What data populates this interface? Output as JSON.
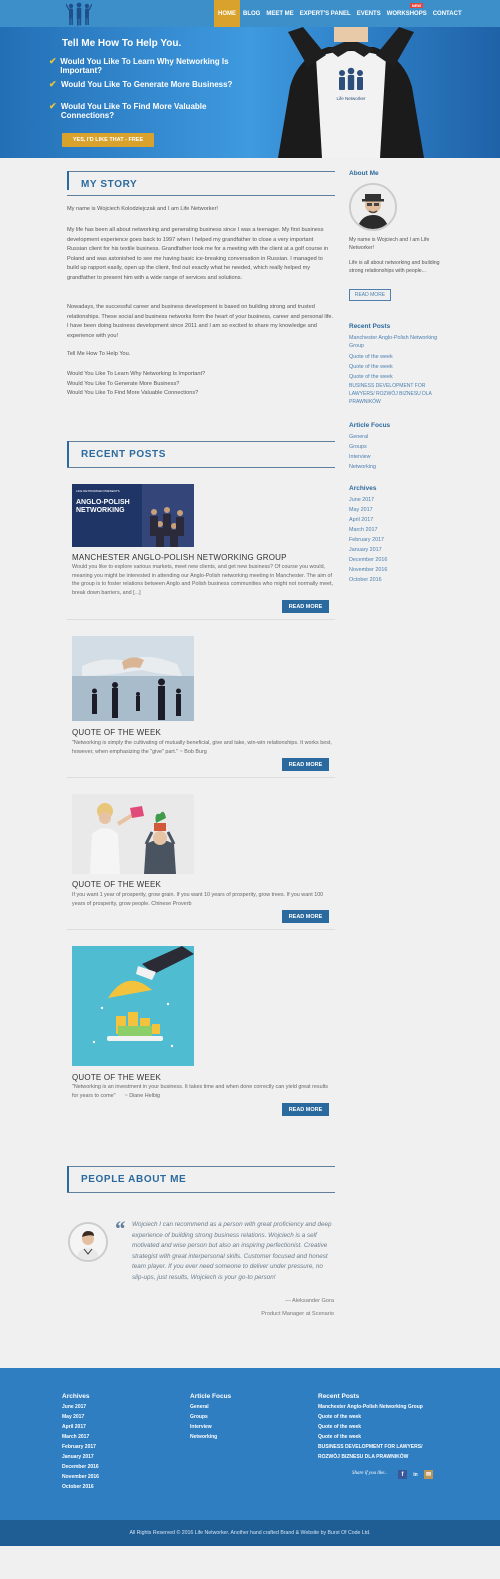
{
  "nav": {
    "items": [
      "HOME",
      "BLOG",
      "MEET ME",
      "EXPERT'S PANEL",
      "EVENTS",
      "WORKSHOPS",
      "CONTACT"
    ],
    "new_badge": "NEW"
  },
  "hero": {
    "title": "Tell Me How To Help You.",
    "items": [
      "Would You Like To Learn Why Networking Is Important?",
      "Would You Like To Generate More Business?",
      "Would You Like To Find More Valuable Connections?"
    ],
    "button": "YES, I'D LIKE THAT - FREE",
    "shirt_text": "Life Networker"
  },
  "story": {
    "title": "MY STORY",
    "paragraphs": [
      "My name is Wojciech Kolodziejczak and I am Life Networker!",
      "My life has been all about networking and generating business since I was a teenager. My first business development experience goes back to 1997 when I helped my grandfather to close a very important Russian client for his textile business. Grandfather took me for a meeting with the client at a golf course in Poland and was astonished to see me having basic ice-breaking conversation in Russian. I managed to build up rapport easily, open up the client, find out exactly what he needed, which really helped my grandfather to present him with a wide range of services and solutions.",
      "Nowadays, the successful career and business development is based on building strong and trusted relationships. These social and business networks form the heart of your business, career and personal life. I have been doing business development since 2011 and I am so excited to share my knowledge and experience with you!",
      "Tell Me How To Help You.",
      "Would You Like To Learn Why Networking Is Important?\nWould You Like To Generate More Business?\nWould You Like To Find More Valuable Connections?"
    ]
  },
  "recent": {
    "title": "RECENT POSTS",
    "read_more": "READ MORE",
    "posts": [
      {
        "title": "MANCHESTER ANGLO-POLISH NETWORKING GROUP",
        "excerpt": "Would you like to explore various markets, meet new clients, and get new business? Of course you would, meaning you might be interested in attending our Anglo-Polish networking meeting in Manchester. The aim of the group is to foster relations between Anglo and Polish business communities who might not normally meet, break down barriers, and [...]",
        "image_caption": "ANGLO-POLISH NETWORKING",
        "image_small": "LIFE NETWORKER PRESENTS"
      },
      {
        "title": "QUOTE OF THE WEEK",
        "excerpt": "\"Networking is simply the cultivating of mutually beneficial, give and take, win-win relationships. It works best, however, when emphasizing the \"give\" part.\" ~ Bob Burg"
      },
      {
        "title": "QUOTE OF THE WEEK",
        "excerpt": "If you want 1 year of prosperity, grow grain. If you want 10 years of prosperity, grow trees. If you want 100 years of prosperity, grow people. Chinese Proverb"
      },
      {
        "title": "QUOTE OF THE WEEK",
        "excerpt": "\"Networking is an investment in your business. It takes time and when done correctly can yield great results for years to come\"      ~ Diane Helbig"
      }
    ]
  },
  "people": {
    "title": "PEOPLE ABOUT ME",
    "quote": "Wojciech I can recommend as a person with great proficiency and deep experience of building strong business relations. Wojciech is a self motivated and wise person but also an inspiring perfectionist. Creative strategist with great interpersonal skills. Customer focused and honest team player. If you ever need someone to deliver under pressure, no slip-ups, just results, Wojciech is your go-to person!",
    "author": "— Aleksander Gora",
    "role": "Product Manager at Scenario"
  },
  "sidebar": {
    "about_title": "About Me",
    "about_name": "My name is Wojciech and I am Life Networker!",
    "about_text": "Life is all about networking and building strong relationships with people...",
    "read_more": "READ MORE",
    "recent_title": "Recent Posts",
    "recent_links": [
      "Manchester Anglo-Polish Networking Group",
      "Quote of the week",
      "Quote of the week",
      "Quote of the week",
      "BUSINESS DEVELOPMENT FOR LAWYERS/ ROZWÓJ BIZNESU DLA PRAWNIKÓW"
    ],
    "focus_title": "Article Focus",
    "focus_links": [
      "General",
      "Groups",
      "Interview",
      "Networking"
    ],
    "archives_title": "Archives",
    "archives": [
      "June 2017",
      "May 2017",
      "April 2017",
      "March 2017",
      "February 2017",
      "January 2017",
      "December 2016",
      "November 2016",
      "October 2016"
    ]
  },
  "footer": {
    "archives_title": "Archives",
    "archives": [
      "June 2017",
      "May 2017",
      "April 2017",
      "March 2017",
      "February 2017",
      "January 2017",
      "December 2016",
      "November 2016",
      "October 2016"
    ],
    "focus_title": "Article Focus",
    "focus": [
      "General",
      "Groups",
      "Interview",
      "Networking"
    ],
    "recent_title": "Recent Posts",
    "recent": [
      "Manchester Anglo-Polish Networking Group",
      "Quote of the week",
      "Quote of the week",
      "Quote of the week",
      "BUSINESS DEVELOPMENT FOR LAWYERS/ ROZWÓJ BIZNESU DLA PRAWNIKÓW"
    ],
    "share": "Share if you like..",
    "copyright": "All Rights Reserved © 2016 Life Networker. Another hand crafted Brand & Website by Burst Of Code Ltd."
  },
  "colors": {
    "nav": "#3d8fc9",
    "accent": "#d8a22c",
    "brand": "#2b6a9e",
    "footer": "#2f7ec2"
  }
}
